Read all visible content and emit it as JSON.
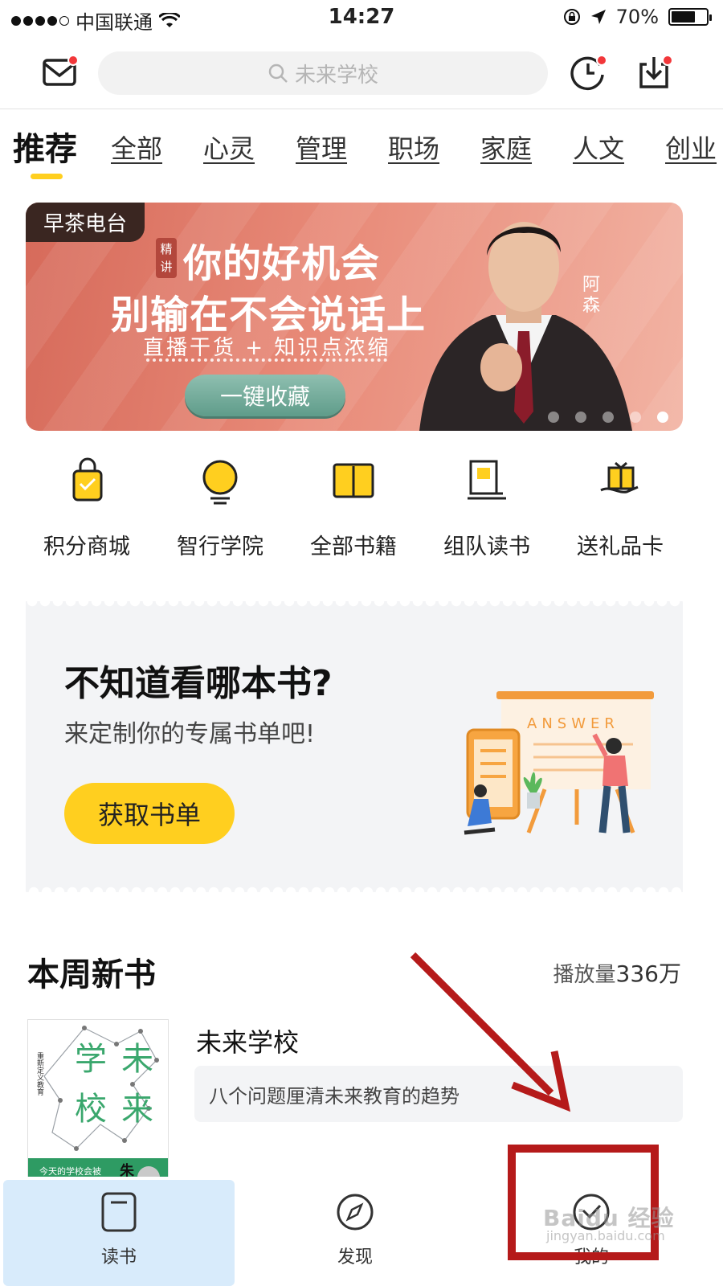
{
  "status_bar": {
    "carrier": "中国联通",
    "time": "14:27",
    "battery_percent": "70%",
    "battery_level": 0.7
  },
  "header": {
    "search_placeholder": "未来学校",
    "icons": [
      "mail-icon",
      "history-clock-icon",
      "download-icon"
    ],
    "badge_color": "#f2373a"
  },
  "tabs": {
    "items": [
      "推荐",
      "全部",
      "心灵",
      "管理",
      "职场",
      "家庭",
      "人文",
      "创业"
    ],
    "active_index": 0,
    "indicator_color": "#ffcf1f"
  },
  "banner": {
    "tag": "早茶电台",
    "badge": "精讲",
    "title_line1": "你的好机会",
    "title_line2": "别输在不会说话上",
    "subtitle": "直播干货 + 知识点浓缩",
    "cta": "一键收藏",
    "author": "阿森",
    "page_count": 5,
    "active_page": 4
  },
  "shortcuts": [
    {
      "label": "积分商城",
      "icon": "shopping-bag-icon"
    },
    {
      "label": "智行学院",
      "icon": "lightbulb-icon"
    },
    {
      "label": "全部书籍",
      "icon": "open-book-icon"
    },
    {
      "label": "组队读书",
      "icon": "book-flag-icon"
    },
    {
      "label": "送礼品卡",
      "icon": "gift-card-icon"
    }
  ],
  "recommend": {
    "title": "不知道看哪本书?",
    "subtitle": "来定制你的专属书单吧!",
    "button": "获取书单",
    "illustration_text": "ANSWER",
    "accent": "#ffcf1f"
  },
  "new_books": {
    "title": "本周新书",
    "play_label": "播放量",
    "play_value": "336万",
    "book": {
      "name": "未来学校",
      "description": "八个问题厘清未来教育的趋势",
      "cover_chars": [
        "学",
        "未",
        "校",
        "来"
      ],
      "cover_side_text": "重新定义教育",
      "cover_banner": "今天的学校会被",
      "cover_author_char": "朱"
    }
  },
  "bottom_nav": {
    "items": [
      {
        "label": "读书",
        "icon": "book-icon"
      },
      {
        "label": "发现",
        "icon": "compass-icon"
      },
      {
        "label": "我的",
        "icon": "profile-icon"
      }
    ],
    "active_index": 0
  },
  "watermark": {
    "text": "Baidu 经验",
    "sub": "jingyan.baidu.com"
  }
}
